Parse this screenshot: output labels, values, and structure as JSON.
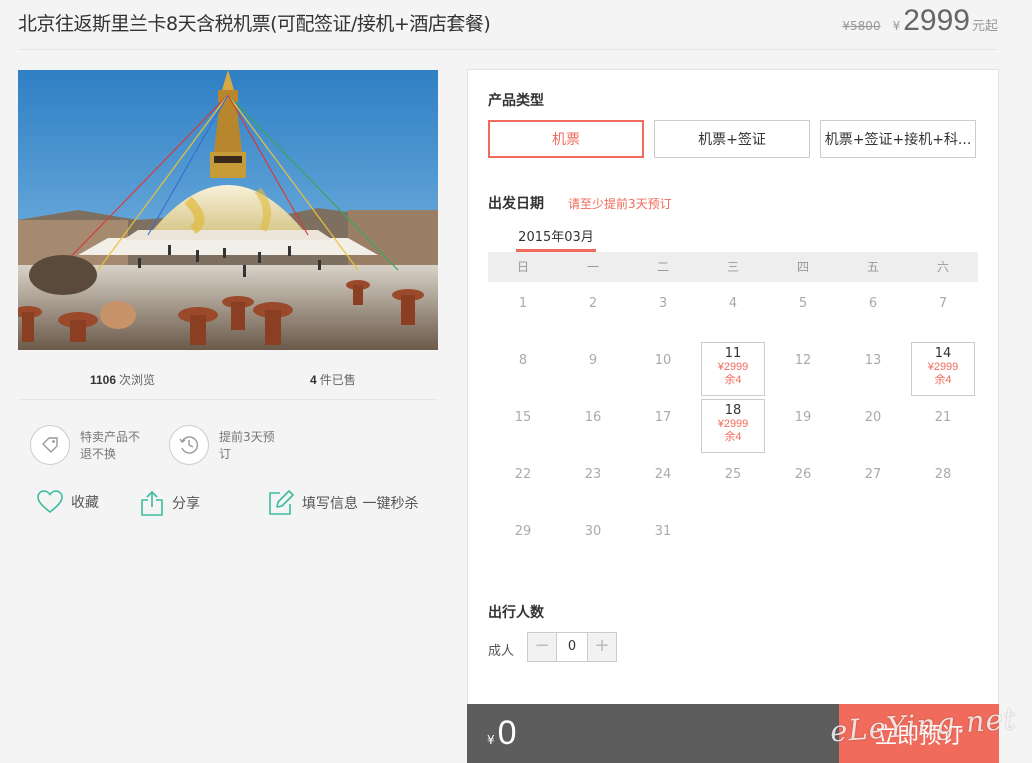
{
  "header": {
    "title": "北京往返斯里兰卡8天含税机票(可配签证/接机+酒店套餐)",
    "old_price": "¥5800",
    "currency": "¥",
    "price": "2999",
    "price_unit": "元起"
  },
  "stats": {
    "views_count": "1106",
    "views_label": "次浏览",
    "sold_count": "4",
    "sold_label": "件已售"
  },
  "features": [
    {
      "icon": "tag-icon",
      "text": "特卖产品不退不换"
    },
    {
      "icon": "clock-icon",
      "text": "提前3天预订"
    }
  ],
  "actions": {
    "favorite": "收藏",
    "share": "分享",
    "quick_book": "填写信息 一键秒杀"
  },
  "booking": {
    "product_type_title": "产品类型",
    "types": [
      "机票",
      "机票+签证",
      "机票+签证+接机+科..."
    ],
    "active_type": 0,
    "date_title": "出发日期",
    "date_note": "请至少提前3天预订",
    "month": "2015年03月",
    "weekdays": [
      "日",
      "一",
      "二",
      "三",
      "四",
      "五",
      "六"
    ],
    "days": [
      {
        "d": "1"
      },
      {
        "d": "2"
      },
      {
        "d": "3"
      },
      {
        "d": "4"
      },
      {
        "d": "5"
      },
      {
        "d": "6"
      },
      {
        "d": "7"
      },
      {
        "d": "8"
      },
      {
        "d": "9"
      },
      {
        "d": "10"
      },
      {
        "d": "11",
        "price": "¥2999",
        "remain": "余4"
      },
      {
        "d": "12"
      },
      {
        "d": "13"
      },
      {
        "d": "14",
        "price": "¥2999",
        "remain": "余4"
      },
      {
        "d": "15"
      },
      {
        "d": "16"
      },
      {
        "d": "17"
      },
      {
        "d": "18",
        "price": "¥2999",
        "remain": "余4"
      },
      {
        "d": "19"
      },
      {
        "d": "20"
      },
      {
        "d": "21"
      },
      {
        "d": "22"
      },
      {
        "d": "23"
      },
      {
        "d": "24"
      },
      {
        "d": "25"
      },
      {
        "d": "26"
      },
      {
        "d": "27"
      },
      {
        "d": "28"
      },
      {
        "d": "29"
      },
      {
        "d": "30"
      },
      {
        "d": "31"
      }
    ],
    "people_title": "出行人数",
    "adult_label": "成人",
    "minus": "−",
    "plus": "+",
    "adult_count": "0"
  },
  "footer": {
    "currency": "¥",
    "total": "0",
    "book_label": "立即预订"
  },
  "watermark": "eLeYing.net",
  "colors": {
    "accent": "#f06b5b",
    "green_icon": "#3dbb9e",
    "footer_bg": "#5d5d5d"
  }
}
